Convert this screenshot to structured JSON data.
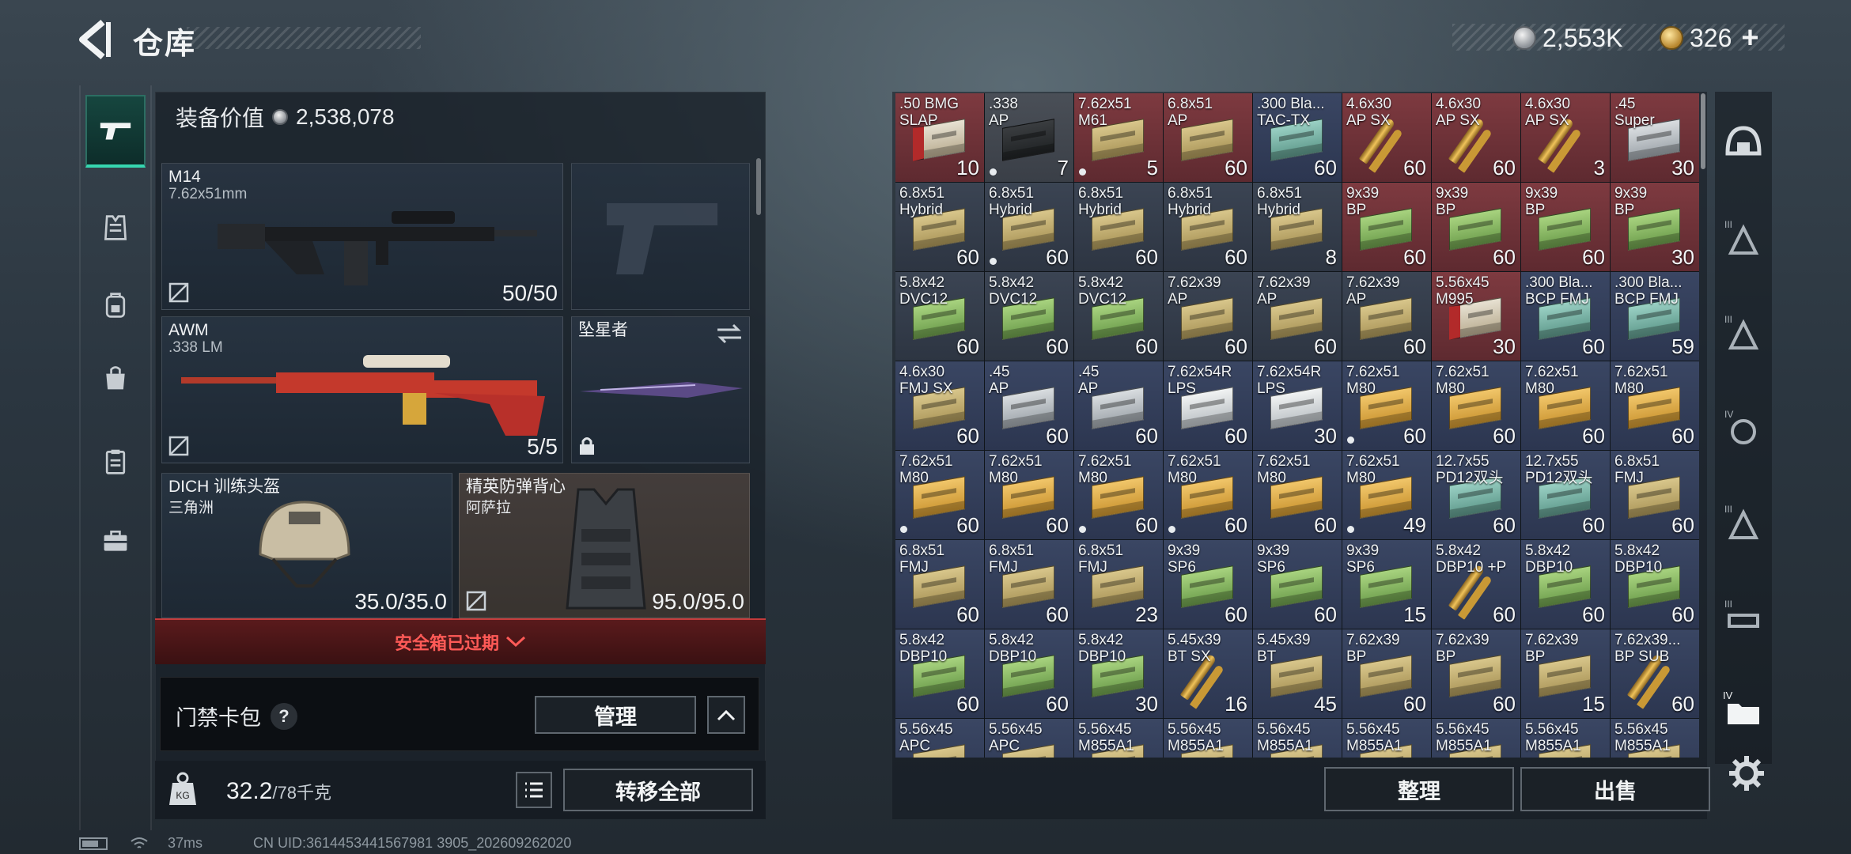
{
  "header": {
    "title": "仓库"
  },
  "currency": {
    "silver": "2,553K",
    "gold": "326"
  },
  "loadout": {
    "equip_value_label": "装备价值",
    "equip_value": "2,538,078",
    "primary": {
      "name": "M14",
      "ammo": "7.62x51mm",
      "durability": "50/50"
    },
    "secondary": {
      "name": "AWM",
      "ammo": ".338 LM",
      "durability": "5/5"
    },
    "melee": {
      "name": "坠星者"
    },
    "helmet": {
      "name": "DICH 训练头盔",
      "sub": "三角洲",
      "durability": "35.0/35.0"
    },
    "armor": {
      "name": "精英防弹背心",
      "sub": "阿萨拉",
      "durability": "95.0/95.0"
    },
    "safe_box_status": "安全箱已过期",
    "access_card_label": "门禁卡包",
    "manage_label": "管理",
    "weight_current": "32.2",
    "weight_max": "/78千克",
    "transfer_all_label": "转移全部"
  },
  "stash": {
    "organize_label": "整理",
    "sell_label": "出售",
    "items": [
      {
        "name": ".50 BMG\nSLAP",
        "count": "10",
        "color": "red",
        "art": "redcan",
        "dot": false
      },
      {
        "name": ".338\nAP",
        "count": "7",
        "color": "grey",
        "art": "case",
        "dot": true
      },
      {
        "name": "7.62x51\nM61",
        "count": "5",
        "color": "red",
        "art": "tan",
        "dot": true
      },
      {
        "name": "6.8x51\nAP",
        "count": "60",
        "color": "red",
        "art": "tan",
        "dot": false
      },
      {
        "name": ".300 Bla...\nTAC-TX",
        "count": "60",
        "color": "navy",
        "art": "teal",
        "dot": false
      },
      {
        "name": "4.6x30\nAP SX",
        "count": "60",
        "color": "red",
        "art": "shell",
        "dot": false
      },
      {
        "name": "4.6x30\nAP SX",
        "count": "60",
        "color": "red",
        "art": "shell",
        "dot": false
      },
      {
        "name": "4.6x30\nAP SX",
        "count": "3",
        "color": "red",
        "art": "shell",
        "dot": false
      },
      {
        "name": ".45\nSuper",
        "count": "30",
        "color": "red",
        "art": "silver",
        "dot": false
      },
      {
        "name": "6.8x51\nHybrid",
        "count": "60",
        "color": "default",
        "art": "tan",
        "dot": false
      },
      {
        "name": "6.8x51\nHybrid",
        "count": "60",
        "color": "default",
        "art": "tan",
        "dot": true
      },
      {
        "name": "6.8x51\nHybrid",
        "count": "60",
        "color": "default",
        "art": "tan",
        "dot": false
      },
      {
        "name": "6.8x51\nHybrid",
        "count": "60",
        "color": "default",
        "art": "tan",
        "dot": false
      },
      {
        "name": "6.8x51\nHybrid",
        "count": "8",
        "color": "default",
        "art": "tan",
        "dot": false
      },
      {
        "name": "9x39\nBP",
        "count": "60",
        "color": "red",
        "art": "green",
        "dot": false
      },
      {
        "name": "9x39\nBP",
        "count": "60",
        "color": "red",
        "art": "green",
        "dot": false
      },
      {
        "name": "9x39\nBP",
        "count": "60",
        "color": "red",
        "art": "green",
        "dot": false
      },
      {
        "name": "9x39\nBP",
        "count": "30",
        "color": "red",
        "art": "green",
        "dot": false
      },
      {
        "name": "5.8x42\nDVC12",
        "count": "60",
        "color": "default",
        "art": "green",
        "dot": false
      },
      {
        "name": "5.8x42\nDVC12",
        "count": "60",
        "color": "default",
        "art": "green",
        "dot": false
      },
      {
        "name": "5.8x42\nDVC12",
        "count": "60",
        "color": "default",
        "art": "green",
        "dot": false
      },
      {
        "name": "7.62x39\nAP",
        "count": "60",
        "color": "default",
        "art": "tan",
        "dot": false
      },
      {
        "name": "7.62x39\nAP",
        "count": "60",
        "color": "default",
        "art": "tan",
        "dot": false
      },
      {
        "name": "7.62x39\nAP",
        "count": "60",
        "color": "default",
        "art": "tan",
        "dot": false
      },
      {
        "name": "5.56x45\nM995",
        "count": "30",
        "color": "red",
        "art": "redcan",
        "dot": false
      },
      {
        "name": ".300 Bla...\nBCP FMJ",
        "count": "60",
        "color": "navy",
        "art": "teal",
        "dot": false
      },
      {
        "name": ".300 Bla...\nBCP FMJ",
        "count": "59",
        "color": "navy",
        "art": "teal",
        "dot": false
      },
      {
        "name": "4.6x30\nFMJ SX",
        "count": "60",
        "color": "navy",
        "art": "tan",
        "dot": false
      },
      {
        "name": ".45\nAP",
        "count": "60",
        "color": "navy",
        "art": "silver",
        "dot": false
      },
      {
        "name": ".45\nAP",
        "count": "60",
        "color": "navy",
        "art": "silver",
        "dot": false
      },
      {
        "name": "7.62x54R\nLPS",
        "count": "60",
        "color": "navy",
        "art": "white",
        "dot": false
      },
      {
        "name": "7.62x54R\nLPS",
        "count": "30",
        "color": "navy",
        "art": "white",
        "dot": false
      },
      {
        "name": "7.62x51\nM80",
        "count": "60",
        "color": "navy",
        "art": "gold",
        "dot": true
      },
      {
        "name": "7.62x51\nM80",
        "count": "60",
        "color": "navy",
        "art": "gold",
        "dot": false
      },
      {
        "name": "7.62x51\nM80",
        "count": "60",
        "color": "navy",
        "art": "gold",
        "dot": false
      },
      {
        "name": "7.62x51\nM80",
        "count": "60",
        "color": "navy",
        "art": "gold",
        "dot": false
      },
      {
        "name": "7.62x51\nM80",
        "count": "60",
        "color": "navy",
        "art": "gold",
        "dot": true
      },
      {
        "name": "7.62x51\nM80",
        "count": "60",
        "color": "navy",
        "art": "gold",
        "dot": false
      },
      {
        "name": "7.62x51\nM80",
        "count": "60",
        "color": "navy",
        "art": "gold",
        "dot": true
      },
      {
        "name": "7.62x51\nM80",
        "count": "60",
        "color": "navy",
        "art": "gold",
        "dot": true
      },
      {
        "name": "7.62x51\nM80",
        "count": "60",
        "color": "navy",
        "art": "gold",
        "dot": false
      },
      {
        "name": "7.62x51\nM80",
        "count": "49",
        "color": "navy",
        "art": "gold",
        "dot": true
      },
      {
        "name": "12.7x55\nPD12双头",
        "count": "60",
        "color": "navy",
        "art": "teal",
        "dot": false
      },
      {
        "name": "12.7x55\nPD12双头",
        "count": "60",
        "color": "navy",
        "art": "teal",
        "dot": false
      },
      {
        "name": "6.8x51\nFMJ",
        "count": "60",
        "color": "navy",
        "art": "tan",
        "dot": false
      },
      {
        "name": "6.8x51\nFMJ",
        "count": "60",
        "color": "navy",
        "art": "tan",
        "dot": false
      },
      {
        "name": "6.8x51\nFMJ",
        "count": "60",
        "color": "navy",
        "art": "tan",
        "dot": false
      },
      {
        "name": "6.8x51\nFMJ",
        "count": "23",
        "color": "navy",
        "art": "tan",
        "dot": false
      },
      {
        "name": "9x39\nSP6",
        "count": "60",
        "color": "navy",
        "art": "green",
        "dot": false
      },
      {
        "name": "9x39\nSP6",
        "count": "60",
        "color": "navy",
        "art": "green",
        "dot": false
      },
      {
        "name": "9x39\nSP6",
        "count": "15",
        "color": "navy",
        "art": "green",
        "dot": false
      },
      {
        "name": "5.8x42\nDBP10 +P",
        "count": "60",
        "color": "navy",
        "art": "shell",
        "dot": false
      },
      {
        "name": "5.8x42\nDBP10",
        "count": "60",
        "color": "navy",
        "art": "green",
        "dot": false
      },
      {
        "name": "5.8x42\nDBP10",
        "count": "60",
        "color": "navy",
        "art": "green",
        "dot": false
      },
      {
        "name": "5.8x42\nDBP10",
        "count": "60",
        "color": "navy",
        "art": "green",
        "dot": false
      },
      {
        "name": "5.8x42\nDBP10",
        "count": "60",
        "color": "navy",
        "art": "green",
        "dot": false
      },
      {
        "name": "5.8x42\nDBP10",
        "count": "30",
        "color": "navy",
        "art": "green",
        "dot": false
      },
      {
        "name": "5.45x39\nBT SX",
        "count": "16",
        "color": "navy",
        "art": "shell",
        "dot": false
      },
      {
        "name": "5.45x39\nBT",
        "count": "45",
        "color": "navy",
        "art": "tan",
        "dot": false
      },
      {
        "name": "7.62x39\nBP",
        "count": "60",
        "color": "navy",
        "art": "tan",
        "dot": false
      },
      {
        "name": "7.62x39\nBP",
        "count": "60",
        "color": "navy",
        "art": "tan",
        "dot": false
      },
      {
        "name": "7.62x39\nBP",
        "count": "15",
        "color": "navy",
        "art": "tan",
        "dot": false
      },
      {
        "name": "7.62x39...\nBP SUB",
        "count": "60",
        "color": "navy",
        "art": "shell",
        "dot": false
      },
      {
        "name": "5.56x45\nAPC",
        "count": "",
        "color": "navy",
        "art": "tan",
        "dot": false
      },
      {
        "name": "5.56x45\nAPC",
        "count": "",
        "color": "navy",
        "art": "tan",
        "dot": false
      },
      {
        "name": "5.56x45\nM855A1",
        "count": "",
        "color": "navy",
        "art": "tan",
        "dot": false
      },
      {
        "name": "5.56x45\nM855A1",
        "count": "",
        "color": "navy",
        "art": "tan",
        "dot": false
      },
      {
        "name": "5.56x45\nM855A1",
        "count": "",
        "color": "navy",
        "art": "tan",
        "dot": false
      },
      {
        "name": "5.56x45\nM855A1",
        "count": "",
        "color": "navy",
        "art": "tan",
        "dot": false
      },
      {
        "name": "5.56x45\nM855A1",
        "count": "",
        "color": "navy",
        "art": "tan",
        "dot": false
      },
      {
        "name": "5.56x45\nM855A1",
        "count": "",
        "color": "navy",
        "art": "tan",
        "dot": false
      },
      {
        "name": "5.56x45\nM855A1",
        "count": "",
        "color": "navy",
        "art": "tan",
        "dot": false
      }
    ]
  },
  "right_tabs": [
    "helmet-level-3-icon",
    "armor-level-3-icon",
    "armor-level-4-icon",
    "backpack-level-3-icon",
    "rig-level-3-icon",
    "container-level-4-icon"
  ],
  "status": {
    "ping": "37ms",
    "uid": "CN UID:3614453441567981 3905_202609262020"
  }
}
